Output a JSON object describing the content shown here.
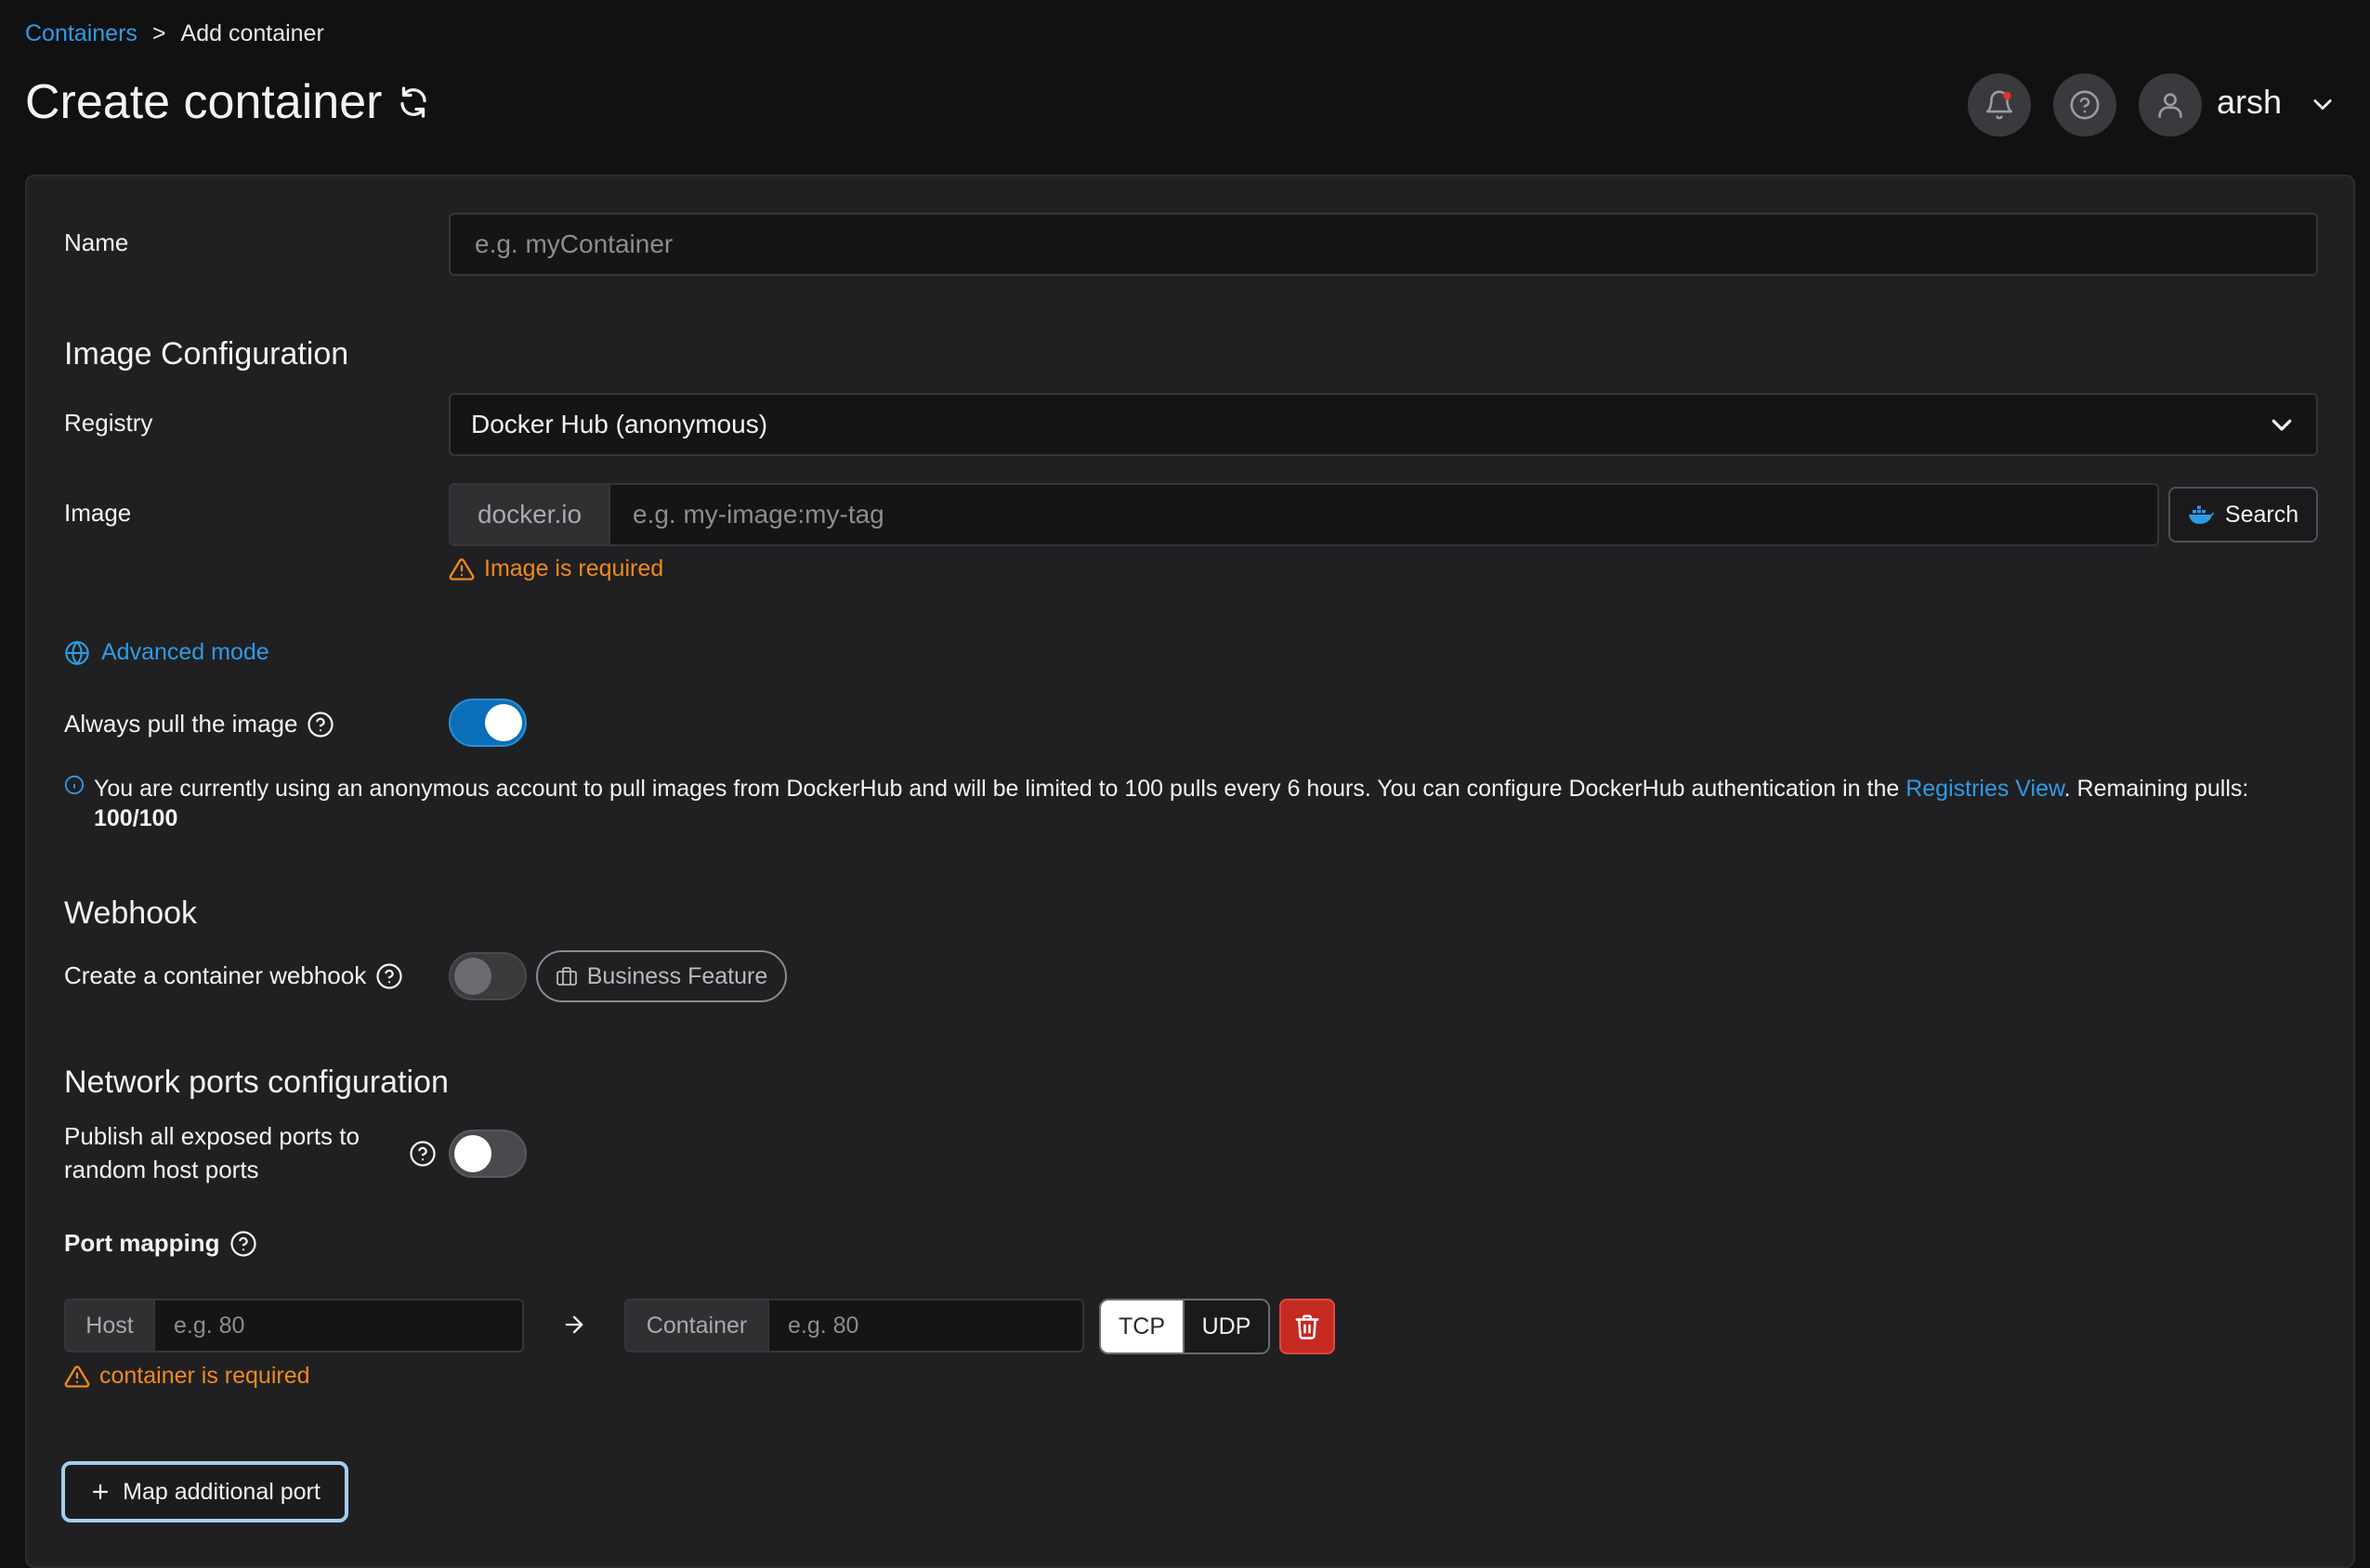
{
  "breadcrumb": {
    "parent": "Containers",
    "separator": ">",
    "current": "Add container"
  },
  "page": {
    "title": "Create container"
  },
  "user": {
    "name": "arsh"
  },
  "form": {
    "name_label": "Name",
    "name_placeholder": "e.g. myContainer",
    "image_config_title": "Image Configuration",
    "registry_label": "Registry",
    "registry_value": "Docker Hub (anonymous)",
    "image_label": "Image",
    "image_prefix": "docker.io",
    "image_placeholder": "e.g. my-image:my-tag",
    "search_label": "Search",
    "image_error": "Image is required",
    "advanced_mode": "Advanced mode",
    "always_pull_label": "Always pull the image",
    "always_pull_on": true,
    "info_text": "You are currently using an anonymous account to pull images from DockerHub and will be limited to 100 pulls every 6 hours. You can configure DockerHub authentication in the",
    "info_link": "Registries View",
    "info_remaining": ". Remaining pulls:",
    "info_count": "100/100",
    "webhook_title": "Webhook",
    "webhook_label": "Create a container webhook",
    "business_feature": "Business Feature",
    "network_title": "Network ports configuration",
    "publish_label": "Publish all exposed ports to random host ports",
    "publish_on": false,
    "port_mapping_label": "Port mapping",
    "host_addon": "Host",
    "host_placeholder": "e.g. 80",
    "container_addon": "Container",
    "container_placeholder": "e.g. 80",
    "tcp_label": "TCP",
    "udp_label": "UDP",
    "container_error": "container is required",
    "map_port_label": "Map additional port"
  },
  "colors": {
    "accent": "#2f9be6",
    "toggle_on": "#0a6fb8",
    "warning": "#f08a1c",
    "danger": "#c42a20"
  }
}
